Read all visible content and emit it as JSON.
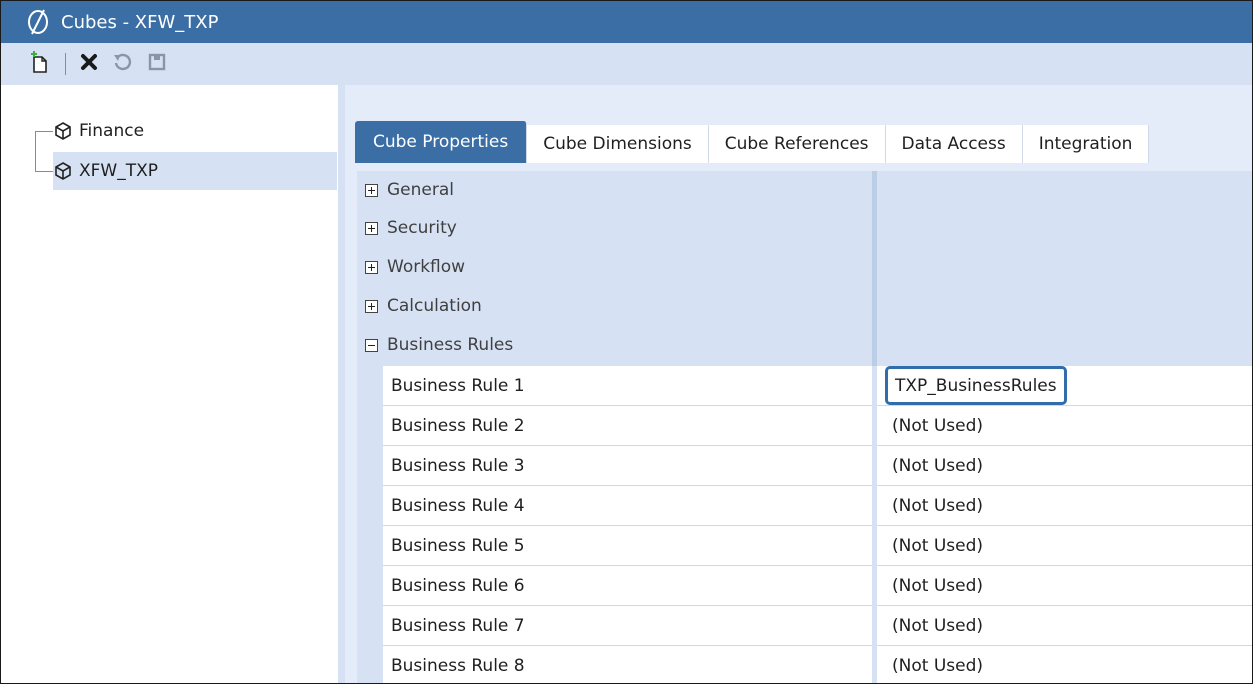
{
  "window": {
    "title": "Cubes - XFW_TXP"
  },
  "toolbar": {
    "buttons": [
      {
        "icon": "new-cube-icon"
      },
      {
        "icon": "delete-icon"
      },
      {
        "icon": "revert-icon"
      },
      {
        "icon": "save-icon"
      }
    ]
  },
  "tree": {
    "items": [
      {
        "label": "Finance",
        "icon": "cube-icon",
        "selected": false
      },
      {
        "label": "XFW_TXP",
        "icon": "cube-icon",
        "selected": true
      }
    ]
  },
  "tabs": [
    {
      "label": "Cube Properties",
      "active": true
    },
    {
      "label": "Cube Dimensions",
      "active": false
    },
    {
      "label": "Cube References",
      "active": false
    },
    {
      "label": "Data Access",
      "active": false
    },
    {
      "label": "Integration",
      "active": false
    }
  ],
  "categories": [
    {
      "label": "General",
      "expanded": false
    },
    {
      "label": "Security",
      "expanded": false
    },
    {
      "label": "Workflow",
      "expanded": false
    },
    {
      "label": "Calculation",
      "expanded": false
    },
    {
      "label": "Business Rules",
      "expanded": true
    }
  ],
  "properties": [
    {
      "name": "Business Rule 1",
      "value": "TXP_BusinessRules"
    },
    {
      "name": "Business Rule 2",
      "value": "(Not Used)"
    },
    {
      "name": "Business Rule 3",
      "value": "(Not Used)"
    },
    {
      "name": "Business Rule 4",
      "value": "(Not Used)"
    },
    {
      "name": "Business Rule 5",
      "value": "(Not Used)"
    },
    {
      "name": "Business Rule 6",
      "value": "(Not Used)"
    },
    {
      "name": "Business Rule 7",
      "value": "(Not Used)"
    },
    {
      "name": "Business Rule 8",
      "value": "(Not Used)"
    }
  ],
  "colors": {
    "accent": "#3a6ea5",
    "panel": "#d6e2f4",
    "focus": "#2f6eaa"
  }
}
